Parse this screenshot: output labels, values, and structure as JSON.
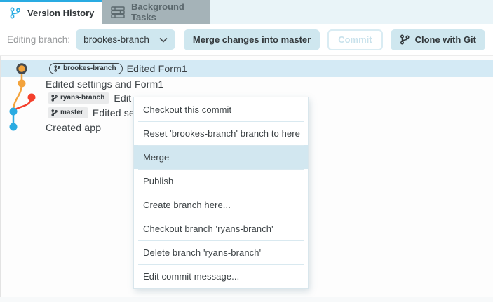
{
  "tabs": [
    {
      "label": "Version History",
      "active": true
    },
    {
      "label": "Background Tasks",
      "active": false
    }
  ],
  "toolbar": {
    "editing_branch_label": "Editing branch:",
    "branch_select": {
      "value": "brookes-branch"
    },
    "merge_button_label": "Merge changes into master",
    "commit_button_label": "Commit",
    "clone_button_label": "Clone with Git"
  },
  "commits": [
    {
      "badge": "brookes-branch",
      "badge_style": "outlined",
      "message": "Edited Form1",
      "dot": "orange-ringed",
      "selected": true
    },
    {
      "message": "Edited settings and Form1",
      "dot": "orange"
    },
    {
      "badge": "ryans-branch",
      "badge_style": "filled",
      "message": "Edit",
      "dot": "red"
    },
    {
      "badge": "master",
      "badge_style": "filled",
      "message": "Edited se",
      "dot": "blue"
    },
    {
      "message": "Created app",
      "dot": "blue"
    }
  ],
  "context_menu": {
    "highlighted_item": "Merge",
    "items": [
      "Checkout this commit",
      "Reset 'brookes-branch' branch to here",
      "Merge",
      "Publish",
      "Create branch here...",
      "Checkout branch 'ryans-branch'",
      "Delete branch 'ryans-branch'",
      "Edit commit message..."
    ]
  },
  "colors": {
    "accent_blue": "#29abe2",
    "graph_orange": "#f3a33c",
    "graph_red": "#f4402c",
    "graph_blue": "#29abe2",
    "graph_ring": "#454a4e",
    "button_bg": "#cfe7ef",
    "row_highlight": "#d4eaf5",
    "menu_highlight": "#d2e7f0",
    "inactive_tab_bg": "#a5b3b8"
  }
}
